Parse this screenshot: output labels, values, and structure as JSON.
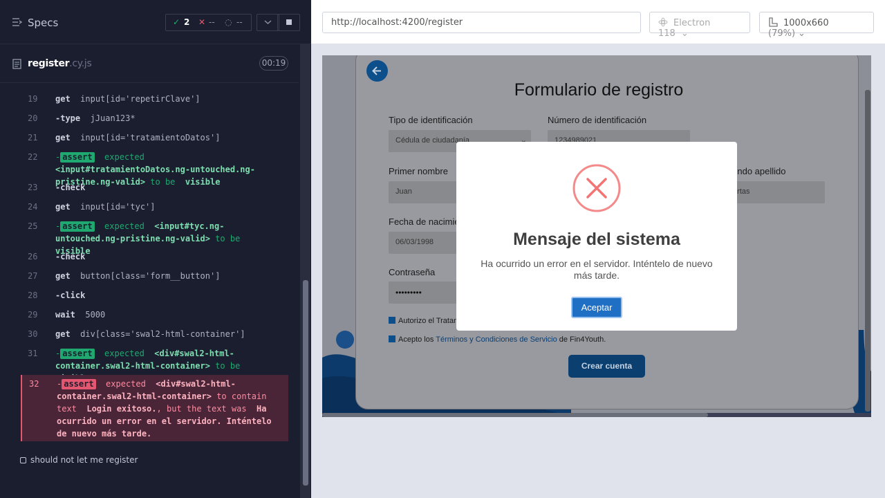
{
  "sidebar": {
    "title": "Specs",
    "stats": {
      "passed": "2",
      "failed": "--",
      "pending": "--"
    },
    "file": {
      "name": "register",
      "ext": ".cy.js",
      "time": "00:19"
    },
    "log": [
      {
        "n": "19",
        "cmd": "get",
        "arg": "input[id='repetirClave']"
      },
      {
        "n": "20",
        "cmd": "-type",
        "arg": "jJuan123*"
      },
      {
        "n": "21",
        "cmd": "get",
        "arg": "input[id='tratamientoDatos']"
      },
      {
        "n": "22",
        "pre": "-",
        "badge": "assert",
        "exp": "expected",
        "el": "<input#tratamientoDatos.ng-untouched.ng-pristine.ng-valid>",
        "tobe": "to be",
        "st": "visible"
      },
      {
        "n": "23",
        "cmd": "-check"
      },
      {
        "n": "24",
        "cmd": "get",
        "arg": "input[id='tyc']"
      },
      {
        "n": "25",
        "pre": "-",
        "badge": "assert",
        "exp": "expected",
        "el": "<input#tyc.ng-untouched.ng-pristine.ng-valid>",
        "tobe": "to be",
        "st": "visible"
      },
      {
        "n": "26",
        "cmd": "-check"
      },
      {
        "n": "27",
        "cmd": "get",
        "arg": "button[class='form__button']"
      },
      {
        "n": "28",
        "cmd": "-click"
      },
      {
        "n": "29",
        "cmd": "wait",
        "arg": "5000"
      },
      {
        "n": "30",
        "cmd": "get",
        "arg": "div[class='swal2-html-container']"
      },
      {
        "n": "31",
        "pre": "-",
        "badge": "assert",
        "exp": "expected",
        "el": "<div#swal2-html-container.swal2-html-container>",
        "tobe": "to be",
        "st": "visible"
      },
      {
        "n": "32",
        "pre": "-",
        "badge": "assert",
        "exp": "expected",
        "el": "<div#swal2-html-container.swal2-html-container>",
        "tobe": "to contain text",
        "st": "Login exitoso.",
        "sep": ", but the text was",
        "actual": "Ha ocurrido un error en el servidor. Inténtelo de nuevo más tarde."
      }
    ],
    "test": "should not let me register"
  },
  "browser": {
    "url": "http://localhost:4200/register",
    "engine": "Electron 118",
    "viewport": "1000x660",
    "zoom": "(79%)"
  },
  "form": {
    "title": "Formulario de registro",
    "labels": {
      "tipo": "Tipo de identificación",
      "numero": "Número de identificación",
      "nombre": "Primer nombre",
      "apellido2": "Segundo apellido",
      "fecha": "Fecha de nacimiento",
      "clave": "Contraseña"
    },
    "values": {
      "tipo": "Cédula de ciudadanía",
      "numero": "1234989021",
      "nombre": "Juan",
      "apellido2": "Cuartas",
      "fecha": "06/03/1998",
      "clave": "•••••••••"
    },
    "check1": "Autorizo el Tratamiento de datos",
    "check2_pre": "Acepto los",
    "check2_link": "Términos y Condiciones de Servicio",
    "check2_post": "de Fin4Youth.",
    "submit": "Crear cuenta"
  },
  "modal": {
    "title": "Mensaje del sistema",
    "text": "Ha ocurrido un error en el servidor. Inténtelo de nuevo más tarde.",
    "button": "Aceptar"
  },
  "colors": {
    "pass": "#1fa971",
    "fail": "#e45770",
    "error_icon": "#f27474",
    "primary": "#1f6fc4"
  }
}
